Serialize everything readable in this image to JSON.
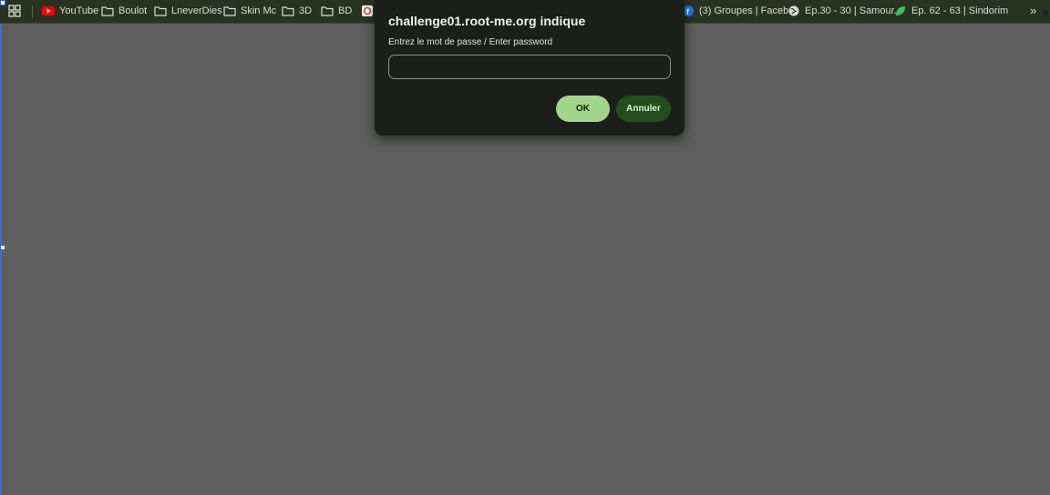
{
  "bookmarks": [
    {
      "label": "YouTube",
      "icon": "youtube-icon"
    },
    {
      "label": "Boulot",
      "icon": "folder-icon"
    },
    {
      "label": "LneverDies",
      "icon": "folder-icon"
    },
    {
      "label": "Skin Mc",
      "icon": "folder-icon"
    },
    {
      "label": "3D",
      "icon": "folder-icon"
    },
    {
      "label": "BD",
      "icon": "folder-icon"
    },
    {
      "label": "(3) Groupes | Faceb...",
      "icon": "facebook-icon"
    },
    {
      "label": "Ep.30 - 30 | Samour...",
      "icon": "globe-icon"
    },
    {
      "label": "Ep. 62 - 63 | Sindorim",
      "icon": "leaf-icon"
    }
  ],
  "more_label": "»",
  "dialog": {
    "title": "challenge01.root-me.org indique",
    "message": "Entrez le mot de passe / Enter password",
    "input_value": "",
    "ok_label": "OK",
    "cancel_label": "Annuler"
  },
  "colors": {
    "page_background": "#5e5e5e",
    "bookmarks_bar": "#2a3322",
    "dialog_background": "#1b1f1a",
    "ok_button": "#a2d68c",
    "cancel_button": "#234d1d"
  }
}
